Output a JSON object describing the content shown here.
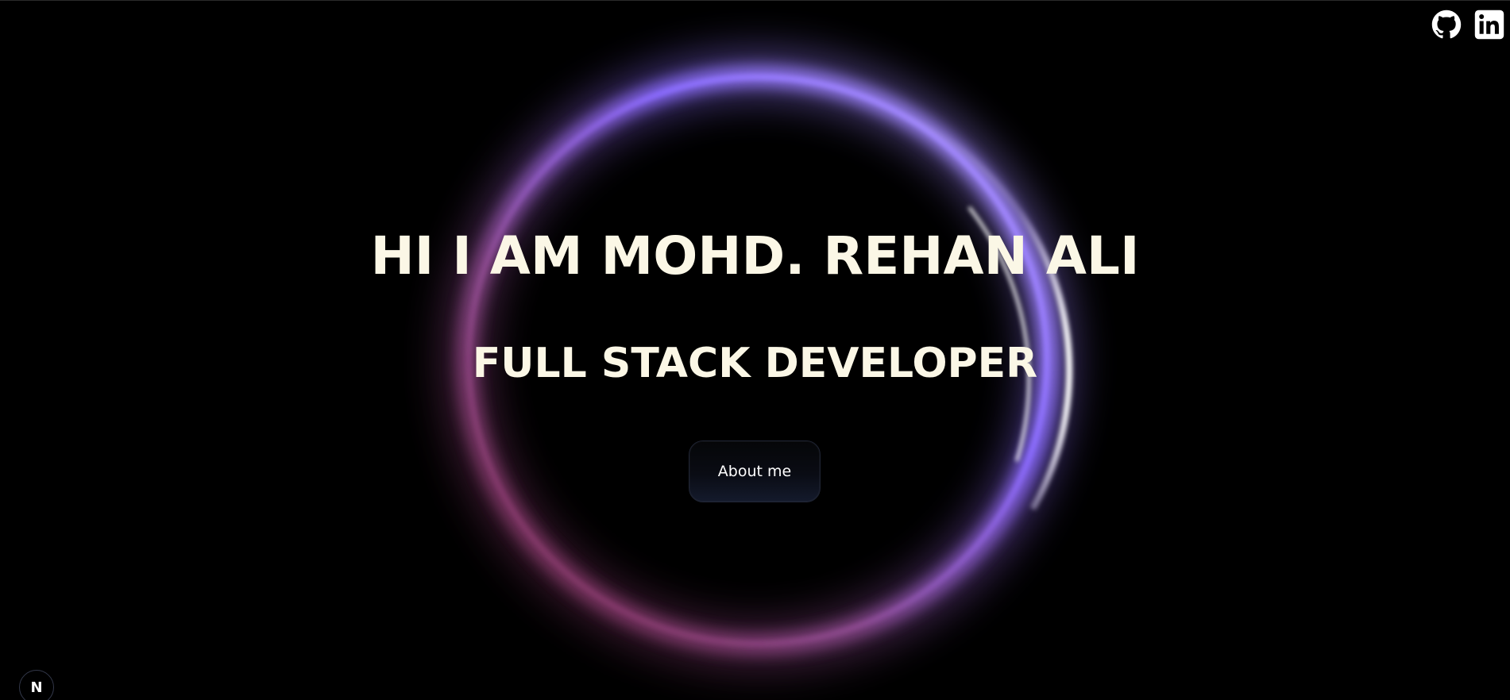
{
  "hero": {
    "title": "HI I AM MOHD. REHAN ALI",
    "subtitle": "FULL STACK DEVELOPER",
    "button_label": "About me"
  },
  "social": {
    "items": [
      {
        "icon": "github-icon"
      },
      {
        "icon": "linkedin-icon"
      }
    ]
  },
  "badge": {
    "letter": "N"
  },
  "colors": {
    "background": "#000000",
    "text": "#fbf7e6",
    "ring_violet": "#9b7bff",
    "ring_magenta": "#8a3560",
    "ring_highlight": "#ffffff"
  }
}
